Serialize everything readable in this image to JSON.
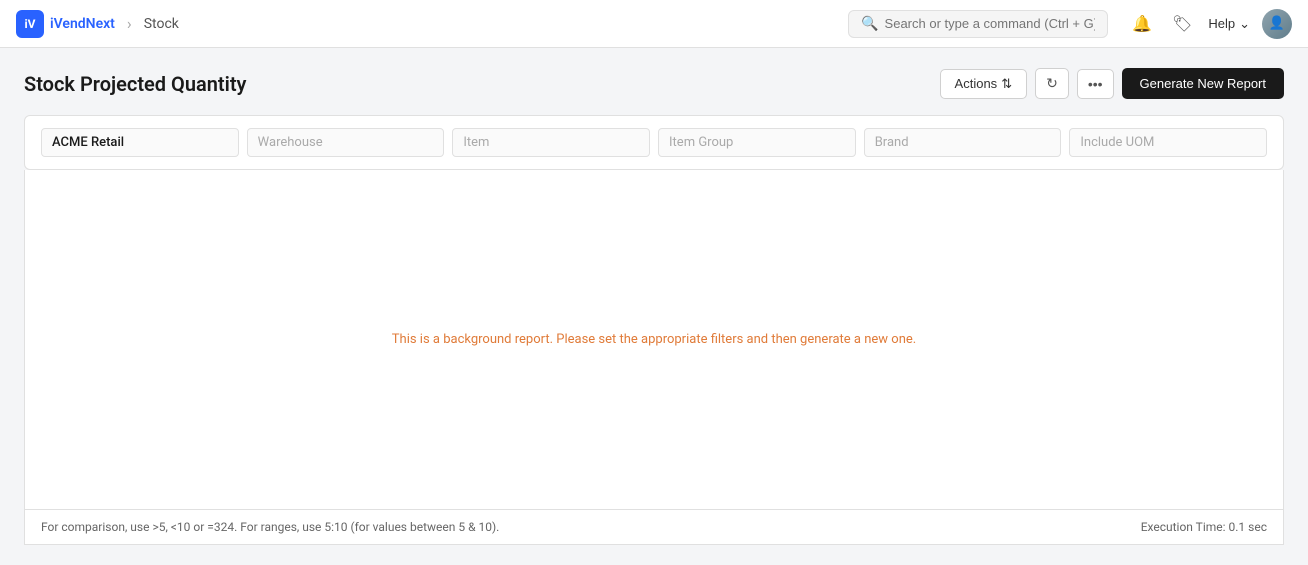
{
  "app": {
    "logo_text": "iVendNext",
    "logo_initials": "iV",
    "breadcrumb_parent": "Stock",
    "nav_separator": "›"
  },
  "search": {
    "placeholder": "Search or type a command (Ctrl + G)"
  },
  "topnav": {
    "help_label": "Help",
    "notification_icon": "🔔",
    "tag_icon": "🏷",
    "chevron": "⌄"
  },
  "page": {
    "title": "Stock Projected Quantity"
  },
  "toolbar": {
    "actions_label": "Actions",
    "actions_chevron": "⇅",
    "refresh_icon": "↻",
    "more_icon": "•••",
    "generate_label": "Generate New Report"
  },
  "filters": {
    "company_value": "ACME Retail",
    "warehouse_placeholder": "Warehouse",
    "item_placeholder": "Item",
    "item_group_placeholder": "Item Group",
    "brand_placeholder": "Brand",
    "include_uom_placeholder": "Include UOM"
  },
  "report": {
    "empty_message": "This is a background report. Please set the appropriate filters and then generate a new one."
  },
  "footer": {
    "hint_text": "For comparison, use >5, <10 or =324. For ranges, use 5:10 (for values between 5 & 10).",
    "execution_text": "Execution Time: 0.1 sec"
  }
}
